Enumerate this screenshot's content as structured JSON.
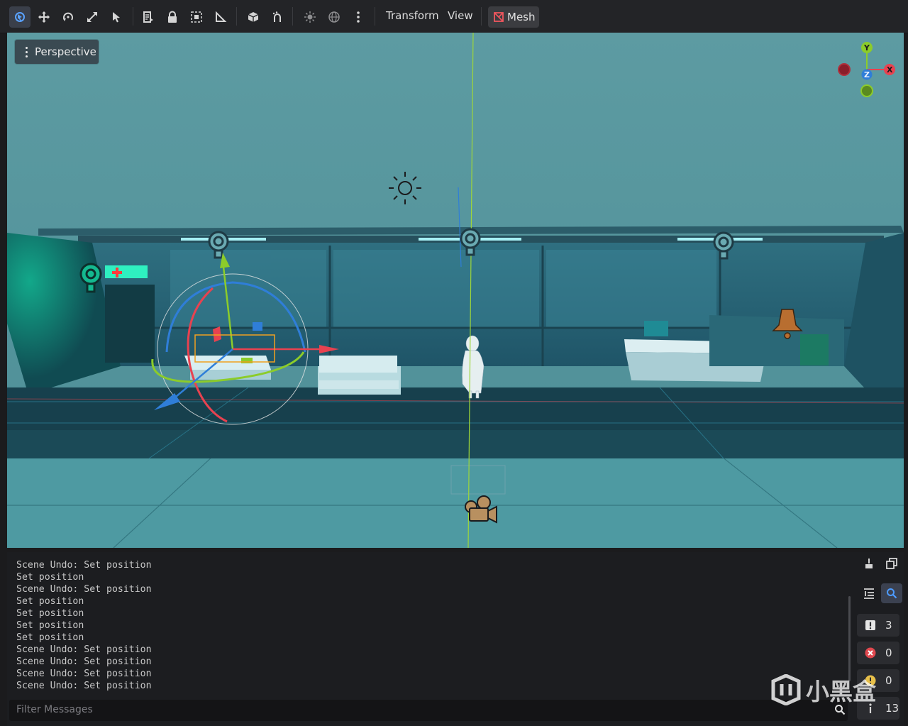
{
  "toolbar": {
    "tools": [
      {
        "name": "select-mode-icon",
        "active": true
      },
      {
        "name": "move-mode-icon"
      },
      {
        "name": "rotate-mode-icon"
      },
      {
        "name": "scale-mode-icon"
      },
      {
        "name": "list-select-icon"
      },
      {
        "name": "script-list-icon"
      },
      {
        "name": "lock-icon"
      },
      {
        "name": "group-icon"
      },
      {
        "name": "ruler-icon"
      },
      {
        "name": "local-space-icon"
      },
      {
        "name": "snap-icon"
      },
      {
        "name": "sun-preview-icon"
      },
      {
        "name": "environment-preview-icon"
      },
      {
        "name": "more-options-icon"
      }
    ],
    "menus": {
      "transform": "Transform",
      "view": "View",
      "mesh": "Mesh"
    }
  },
  "viewport": {
    "perspective_label": "Perspective",
    "axis_gizmo": {
      "y": "Y",
      "x": "X",
      "z": "Z"
    }
  },
  "output": {
    "lines": [
      "Scene Undo: Set position",
      "Set position",
      "Scene Undo: Set position",
      "Set position",
      "Set position",
      "Set position",
      "Set position",
      "Scene Undo: Set position",
      "Scene Undo: Set position",
      "Scene Undo: Set position",
      "Scene Undo: Set position"
    ],
    "filter_placeholder": "Filter Messages",
    "counts": {
      "messages": "3",
      "errors": "0",
      "warnings": "0",
      "info": "13"
    }
  },
  "watermark": "小黑盒",
  "colors": {
    "accent": "#4d9bff",
    "error": "#e0484f",
    "warning": "#e8c04a",
    "x_axis": "#e84250",
    "y_axis": "#8ccc2a",
    "z_axis": "#2f7ed8"
  }
}
